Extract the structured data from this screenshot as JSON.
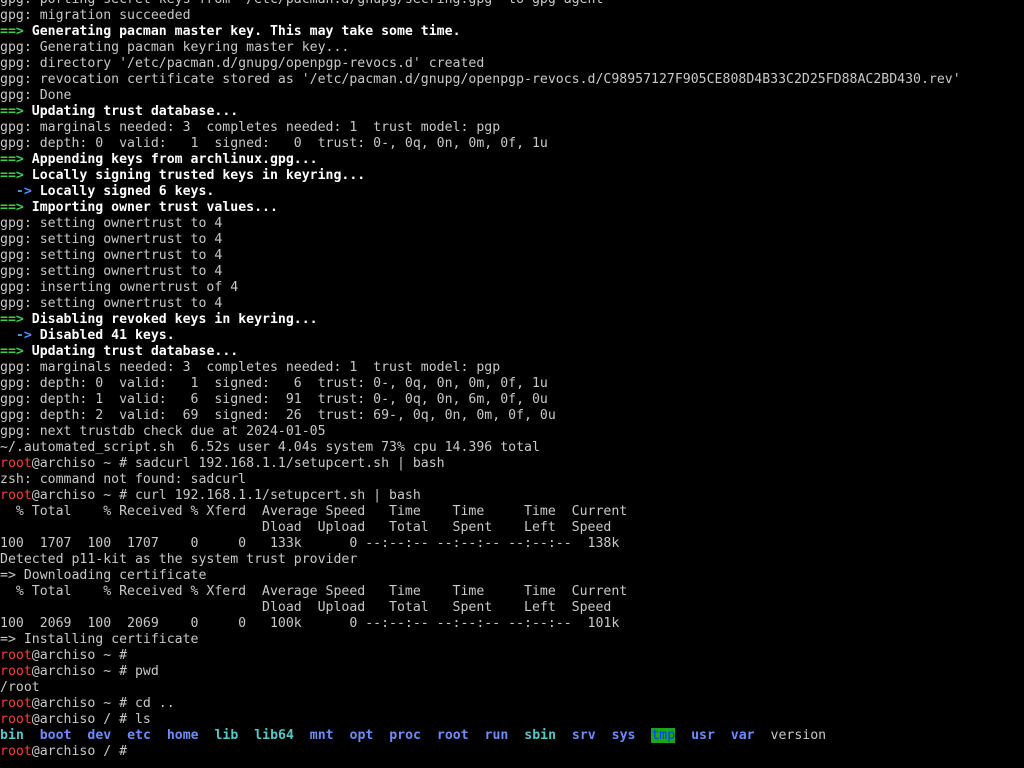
{
  "colors": {
    "background": "#000000",
    "foreground": "#c8c8c8",
    "white": "#ffffff",
    "green_arrow": "#39d353",
    "blue_arrow": "#5c8cff",
    "root_red": "#ff3b3b",
    "dir_blue": "#6d8bff",
    "dir_cyan": "#54c7c7",
    "tmp_bg": "#1aa51a"
  },
  "lines": [
    {
      "kind": "gpg",
      "segments": [
        {
          "text": "gpg: porting secret keys from '/etc/pacman.d/gnupg/secring.gpg' to gpg-agent",
          "color": "#c8c8c8"
        }
      ]
    },
    {
      "kind": "gpg",
      "segments": [
        {
          "text": "gpg: migration succeeded",
          "color": "#c8c8c8"
        }
      ]
    },
    {
      "kind": "step",
      "segments": [
        {
          "text": "==>",
          "color": "#39d353",
          "bold": true
        },
        {
          "text": " Generating pacman master key. This may take some time.",
          "color": "#ffffff",
          "bold": true
        }
      ]
    },
    {
      "kind": "gpg",
      "segments": [
        {
          "text": "gpg: Generating pacman keyring master key...",
          "color": "#c8c8c8"
        }
      ]
    },
    {
      "kind": "gpg",
      "segments": [
        {
          "text": "gpg: directory '/etc/pacman.d/gnupg/openpgp-revocs.d' created",
          "color": "#c8c8c8"
        }
      ]
    },
    {
      "kind": "gpg",
      "segments": [
        {
          "text": "gpg: revocation certificate stored as '/etc/pacman.d/gnupg/openpgp-revocs.d/C98957127F905CE808D4B33C2D25FD88AC2BD430.rev'",
          "color": "#c8c8c8"
        }
      ]
    },
    {
      "kind": "gpg",
      "segments": [
        {
          "text": "gpg: Done",
          "color": "#c8c8c8"
        }
      ]
    },
    {
      "kind": "step",
      "segments": [
        {
          "text": "==>",
          "color": "#39d353",
          "bold": true
        },
        {
          "text": " Updating trust database...",
          "color": "#ffffff",
          "bold": true
        }
      ]
    },
    {
      "kind": "gpg",
      "segments": [
        {
          "text": "gpg: marginals needed: 3  completes needed: 1  trust model: pgp",
          "color": "#c8c8c8"
        }
      ]
    },
    {
      "kind": "gpg",
      "segments": [
        {
          "text": "gpg: depth: 0  valid:   1  signed:   0  trust: 0-, 0q, 0n, 0m, 0f, 1u",
          "color": "#c8c8c8"
        }
      ]
    },
    {
      "kind": "step",
      "segments": [
        {
          "text": "==>",
          "color": "#39d353",
          "bold": true
        },
        {
          "text": " Appending keys from archlinux.gpg...",
          "color": "#ffffff",
          "bold": true
        }
      ]
    },
    {
      "kind": "step",
      "segments": [
        {
          "text": "==>",
          "color": "#39d353",
          "bold": true
        },
        {
          "text": " Locally signing trusted keys in keyring...",
          "color": "#ffffff",
          "bold": true
        }
      ]
    },
    {
      "kind": "substep",
      "segments": [
        {
          "text": "  ->",
          "color": "#5c8cff",
          "bold": true
        },
        {
          "text": " Locally signed 6 keys.",
          "color": "#ffffff",
          "bold": true
        }
      ]
    },
    {
      "kind": "step",
      "segments": [
        {
          "text": "==>",
          "color": "#39d353",
          "bold": true
        },
        {
          "text": " Importing owner trust values...",
          "color": "#ffffff",
          "bold": true
        }
      ]
    },
    {
      "kind": "gpg",
      "segments": [
        {
          "text": "gpg: setting ownertrust to 4",
          "color": "#c8c8c8"
        }
      ]
    },
    {
      "kind": "gpg",
      "segments": [
        {
          "text": "gpg: setting ownertrust to 4",
          "color": "#c8c8c8"
        }
      ]
    },
    {
      "kind": "gpg",
      "segments": [
        {
          "text": "gpg: setting ownertrust to 4",
          "color": "#c8c8c8"
        }
      ]
    },
    {
      "kind": "gpg",
      "segments": [
        {
          "text": "gpg: setting ownertrust to 4",
          "color": "#c8c8c8"
        }
      ]
    },
    {
      "kind": "gpg",
      "segments": [
        {
          "text": "gpg: inserting ownertrust of 4",
          "color": "#c8c8c8"
        }
      ]
    },
    {
      "kind": "gpg",
      "segments": [
        {
          "text": "gpg: setting ownertrust to 4",
          "color": "#c8c8c8"
        }
      ]
    },
    {
      "kind": "step",
      "segments": [
        {
          "text": "==>",
          "color": "#39d353",
          "bold": true
        },
        {
          "text": " Disabling revoked keys in keyring...",
          "color": "#ffffff",
          "bold": true
        }
      ]
    },
    {
      "kind": "substep",
      "segments": [
        {
          "text": "  ->",
          "color": "#5c8cff",
          "bold": true
        },
        {
          "text": " Disabled 41 keys.",
          "color": "#ffffff",
          "bold": true
        }
      ]
    },
    {
      "kind": "step",
      "segments": [
        {
          "text": "==>",
          "color": "#39d353",
          "bold": true
        },
        {
          "text": " Updating trust database...",
          "color": "#ffffff",
          "bold": true
        }
      ]
    },
    {
      "kind": "gpg",
      "segments": [
        {
          "text": "gpg: marginals needed: 3  completes needed: 1  trust model: pgp",
          "color": "#c8c8c8"
        }
      ]
    },
    {
      "kind": "gpg",
      "segments": [
        {
          "text": "gpg: depth: 0  valid:   1  signed:   6  trust: 0-, 0q, 0n, 0m, 0f, 1u",
          "color": "#c8c8c8"
        }
      ]
    },
    {
      "kind": "gpg",
      "segments": [
        {
          "text": "gpg: depth: 1  valid:   6  signed:  91  trust: 0-, 0q, 0n, 6m, 0f, 0u",
          "color": "#c8c8c8"
        }
      ]
    },
    {
      "kind": "gpg",
      "segments": [
        {
          "text": "gpg: depth: 2  valid:  69  signed:  26  trust: 69-, 0q, 0n, 0m, 0f, 0u",
          "color": "#c8c8c8"
        }
      ]
    },
    {
      "kind": "gpg",
      "segments": [
        {
          "text": "gpg: next trustdb check due at 2024-01-05",
          "color": "#c8c8c8"
        }
      ]
    },
    {
      "kind": "output",
      "segments": [
        {
          "text": "~/.automated_script.sh  6.52s user 4.04s system 73% cpu 14.396 total",
          "color": "#c8c8c8"
        }
      ]
    },
    {
      "kind": "prompt",
      "segments": [
        {
          "text": "root",
          "color": "#ff3b3b"
        },
        {
          "text": "@archiso ~ # sadcurl 192.168.1.1/setupcert.sh | bash",
          "color": "#c8c8c8"
        }
      ]
    },
    {
      "kind": "output",
      "segments": [
        {
          "text": "zsh: command not found: sadcurl",
          "color": "#c8c8c8"
        }
      ]
    },
    {
      "kind": "prompt",
      "segments": [
        {
          "text": "root",
          "color": "#ff3b3b"
        },
        {
          "text": "@archiso ~ # curl 192.168.1.1/setupcert.sh | bash",
          "color": "#c8c8c8"
        }
      ]
    },
    {
      "kind": "output",
      "segments": [
        {
          "text": "  % Total    % Received % Xferd  Average Speed   Time    Time     Time  Current",
          "color": "#c8c8c8"
        }
      ]
    },
    {
      "kind": "output",
      "segments": [
        {
          "text": "                                 Dload  Upload   Total   Spent    Left  Speed",
          "color": "#c8c8c8"
        }
      ]
    },
    {
      "kind": "output",
      "segments": [
        {
          "text": "100  1707  100  1707    0     0   133k      0 --:--:-- --:--:-- --:--:--  138k",
          "color": "#c8c8c8"
        }
      ]
    },
    {
      "kind": "output",
      "segments": [
        {
          "text": "Detected p11-kit as the system trust provider",
          "color": "#c8c8c8"
        }
      ]
    },
    {
      "kind": "output",
      "segments": [
        {
          "text": "=> Downloading certificate",
          "color": "#c8c8c8"
        }
      ]
    },
    {
      "kind": "output",
      "segments": [
        {
          "text": "  % Total    % Received % Xferd  Average Speed   Time    Time     Time  Current",
          "color": "#c8c8c8"
        }
      ]
    },
    {
      "kind": "output",
      "segments": [
        {
          "text": "                                 Dload  Upload   Total   Spent    Left  Speed",
          "color": "#c8c8c8"
        }
      ]
    },
    {
      "kind": "output",
      "segments": [
        {
          "text": "100  2069  100  2069    0     0   100k      0 --:--:-- --:--:-- --:--:--  101k",
          "color": "#c8c8c8"
        }
      ]
    },
    {
      "kind": "output",
      "segments": [
        {
          "text": "=> Installing certificate",
          "color": "#c8c8c8"
        }
      ]
    },
    {
      "kind": "prompt",
      "segments": [
        {
          "text": "root",
          "color": "#ff3b3b"
        },
        {
          "text": "@archiso ~ #",
          "color": "#c8c8c8"
        }
      ]
    },
    {
      "kind": "prompt",
      "segments": [
        {
          "text": "root",
          "color": "#ff3b3b"
        },
        {
          "text": "@archiso ~ # pwd",
          "color": "#c8c8c8"
        }
      ]
    },
    {
      "kind": "output",
      "segments": [
        {
          "text": "/root",
          "color": "#c8c8c8"
        }
      ]
    },
    {
      "kind": "prompt",
      "segments": [
        {
          "text": "root",
          "color": "#ff3b3b"
        },
        {
          "text": "@archiso ~ # cd ..",
          "color": "#c8c8c8"
        }
      ]
    },
    {
      "kind": "prompt",
      "segments": [
        {
          "text": "root",
          "color": "#ff3b3b"
        },
        {
          "text": "@archiso / # ls",
          "color": "#c8c8c8"
        }
      ]
    },
    {
      "kind": "ls",
      "segments": [
        {
          "text": "bin",
          "color": "#54c7c7",
          "bold": true
        },
        {
          "text": "  ",
          "color": "#c8c8c8"
        },
        {
          "text": "boot",
          "color": "#6d8bff",
          "bold": true
        },
        {
          "text": "  ",
          "color": "#c8c8c8"
        },
        {
          "text": "dev",
          "color": "#6d8bff",
          "bold": true
        },
        {
          "text": "  ",
          "color": "#c8c8c8"
        },
        {
          "text": "etc",
          "color": "#6d8bff",
          "bold": true
        },
        {
          "text": "  ",
          "color": "#c8c8c8"
        },
        {
          "text": "home",
          "color": "#6d8bff",
          "bold": true
        },
        {
          "text": "  ",
          "color": "#c8c8c8"
        },
        {
          "text": "lib",
          "color": "#54c7c7",
          "bold": true
        },
        {
          "text": "  ",
          "color": "#c8c8c8"
        },
        {
          "text": "lib64",
          "color": "#54c7c7",
          "bold": true
        },
        {
          "text": "  ",
          "color": "#c8c8c8"
        },
        {
          "text": "mnt",
          "color": "#6d8bff",
          "bold": true
        },
        {
          "text": "  ",
          "color": "#c8c8c8"
        },
        {
          "text": "opt",
          "color": "#6d8bff",
          "bold": true
        },
        {
          "text": "  ",
          "color": "#c8c8c8"
        },
        {
          "text": "proc",
          "color": "#6d8bff",
          "bold": true
        },
        {
          "text": "  ",
          "color": "#c8c8c8"
        },
        {
          "text": "root",
          "color": "#6d8bff",
          "bold": true
        },
        {
          "text": "  ",
          "color": "#c8c8c8"
        },
        {
          "text": "run",
          "color": "#6d8bff",
          "bold": true
        },
        {
          "text": "  ",
          "color": "#c8c8c8"
        },
        {
          "text": "sbin",
          "color": "#54c7c7",
          "bold": true
        },
        {
          "text": "  ",
          "color": "#c8c8c8"
        },
        {
          "text": "srv",
          "color": "#6d8bff",
          "bold": true
        },
        {
          "text": "  ",
          "color": "#c8c8c8"
        },
        {
          "text": "sys",
          "color": "#6d8bff",
          "bold": true
        },
        {
          "text": "  ",
          "color": "#c8c8c8"
        },
        {
          "text": "tmp",
          "color": "#003fff",
          "bg": "#1aa51a"
        },
        {
          "text": "  ",
          "color": "#c8c8c8"
        },
        {
          "text": "usr",
          "color": "#6d8bff",
          "bold": true
        },
        {
          "text": "  ",
          "color": "#c8c8c8"
        },
        {
          "text": "var",
          "color": "#6d8bff",
          "bold": true
        },
        {
          "text": "  ",
          "color": "#c8c8c8"
        },
        {
          "text": "version",
          "color": "#c8c8c8"
        }
      ]
    },
    {
      "kind": "prompt",
      "segments": [
        {
          "text": "root",
          "color": "#ff3b3b"
        },
        {
          "text": "@archiso / # ",
          "color": "#c8c8c8"
        }
      ]
    }
  ]
}
